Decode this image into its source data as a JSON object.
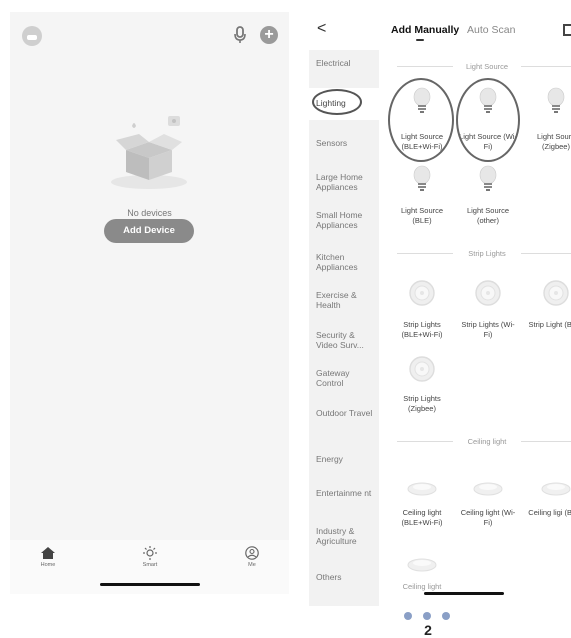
{
  "left_screen": {
    "empty_text": "No devices",
    "add_device_label": "Add Device",
    "tabs": [
      {
        "label": "Home",
        "icon": "home-icon"
      },
      {
        "label": "Smart",
        "icon": "sun-icon"
      },
      {
        "label": "Me",
        "icon": "user-icon"
      }
    ]
  },
  "right_screen": {
    "back_glyph": "<",
    "tab_manual": "Add Manually",
    "tab_autoscan": "Auto Scan",
    "categories": [
      "Electrical",
      "Lighting",
      "Sensors",
      "Large Home Appliances",
      "Small Home Appliances",
      "Kitchen Appliances",
      "Exercise & Health",
      "Security & Video Surv...",
      "Gateway Control",
      "Outdoor Travel",
      "Energy",
      "Entertainme nt",
      "Industry & Agriculture",
      "Others"
    ],
    "sections": {
      "light_source": {
        "title": "Light Source",
        "items": [
          "Light Source (BLE+Wi-Fi)",
          "Light Source (Wi-Fi)",
          "Light Sourc (Zigbee)",
          "Light Source (BLE)",
          "Light Source (other)"
        ]
      },
      "strip_lights": {
        "title": "Strip Lights",
        "items": [
          "Strip Lights (BLE+Wi-Fi)",
          "Strip Lights (Wi-Fi)",
          "Strip Light (BLE)",
          "Strip Lights (Zigbee)"
        ]
      },
      "ceiling_light": {
        "title": "Ceiling light",
        "items": [
          "Ceiling light (BLE+Wi-Fi)",
          "Ceiling light (Wi-Fi)",
          "Ceiling ligi (BLE)",
          "Ceiling light"
        ]
      }
    }
  },
  "pager": {
    "page_number": "2"
  }
}
